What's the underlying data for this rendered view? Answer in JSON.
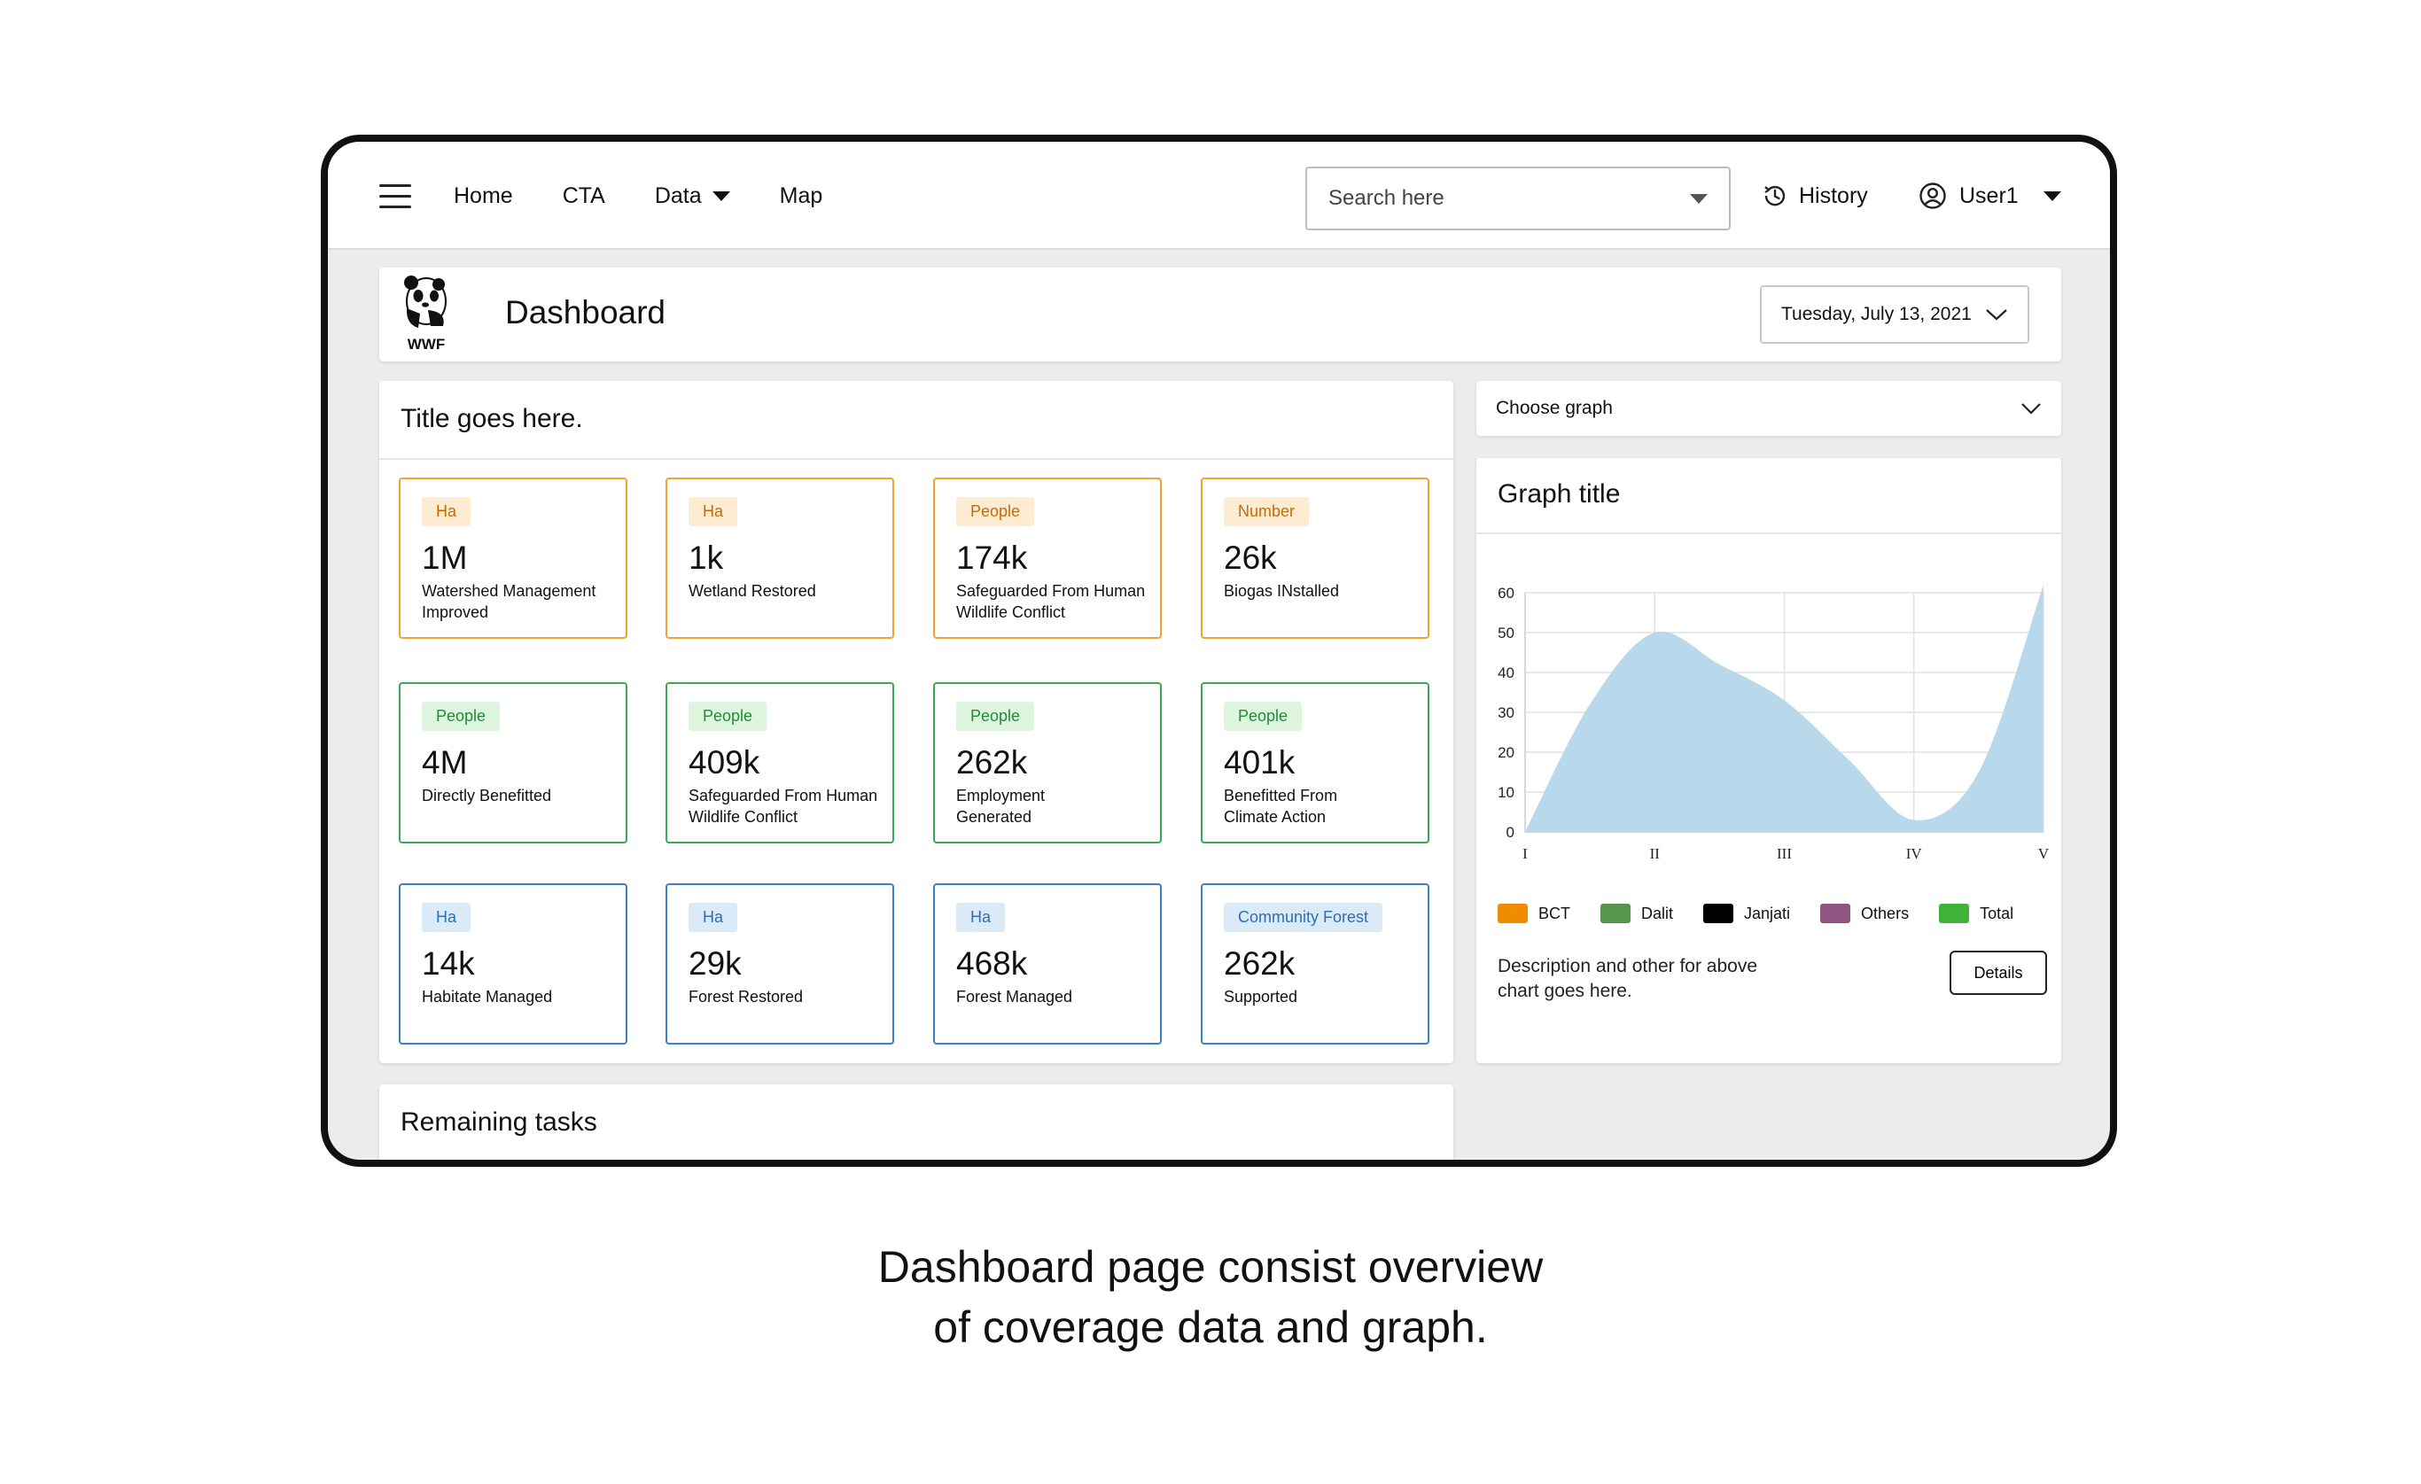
{
  "nav": {
    "links": [
      {
        "label": "Home"
      },
      {
        "label": "CTA"
      },
      {
        "label": "Data"
      },
      {
        "label": "Map"
      }
    ],
    "search_placeholder": "Search here",
    "history_label": "History",
    "user_label": "User1"
  },
  "header": {
    "logo_text": "WWF",
    "title": "Dashboard",
    "date": "Tuesday, July 13, 2021"
  },
  "main": {
    "title": "Title goes here.",
    "kpis": [
      {
        "badge": "Ha",
        "value": "1M",
        "label": "Watershed Management Improved",
        "color": "#f0a332"
      },
      {
        "badge": "Ha",
        "value": "1k",
        "label": "Wetland Restored",
        "color": "#f0a332"
      },
      {
        "badge": "People",
        "value": "174k",
        "label": "Safeguarded From Human Wildlife Conflict",
        "color": "#f0a332"
      },
      {
        "badge": "Number",
        "value": "26k",
        "label": "Biogas INstalled",
        "color": "#f0a332"
      },
      {
        "badge": "People",
        "value": "4M",
        "label": "Directly Benefitted",
        "color": "#38a955"
      },
      {
        "badge": "People",
        "value": "409k",
        "label": "Safeguarded From Human Wildlife Conflict",
        "color": "#38a955"
      },
      {
        "badge": "People",
        "value": "262k",
        "label": "Employment Generated",
        "color": "#38a955"
      },
      {
        "badge": "People",
        "value": "401k",
        "label": "Benefitted From Climate Action",
        "color": "#38a955"
      },
      {
        "badge": "Ha",
        "value": "14k",
        "label": "Habitate Managed",
        "color": "#3c7fc6"
      },
      {
        "badge": "Ha",
        "value": "29k",
        "label": "Forest Restored",
        "color": "#3c7fc6"
      },
      {
        "badge": "Ha",
        "value": "468k",
        "label": "Forest Managed",
        "color": "#3c7fc6"
      },
      {
        "badge": "Community Forest",
        "value": "262k",
        "label": "Supported",
        "color": "#3c7fc6"
      }
    ]
  },
  "tasks": {
    "title": "Remaining tasks"
  },
  "graph": {
    "select_label": "Choose graph",
    "title": "Graph title",
    "description": "Description and other for above chart goes here.",
    "details_label": "Details",
    "legend": [
      {
        "name": "BCT",
        "color": "#ef8c00"
      },
      {
        "name": "Dalit",
        "color": "#57954c"
      },
      {
        "name": "Janjati",
        "color": "#000000"
      },
      {
        "name": "Others",
        "color": "#8e5580"
      },
      {
        "name": "Total",
        "color": "#3fb23a"
      }
    ]
  },
  "chart_data": {
    "type": "area",
    "x": [
      "I",
      "II",
      "III",
      "IV",
      "V"
    ],
    "x_positions": [
      0,
      1,
      2,
      3,
      4
    ],
    "curve_points": [
      [
        0,
        0
      ],
      [
        0.5,
        32
      ],
      [
        1,
        50
      ],
      [
        1.5,
        42
      ],
      [
        2,
        33
      ],
      [
        2.5,
        18
      ],
      [
        3,
        3
      ],
      [
        3.5,
        15
      ],
      [
        4,
        62
      ]
    ],
    "ylim": [
      0,
      60
    ],
    "yticks": [
      0,
      10,
      20,
      30,
      40,
      50,
      60
    ],
    "fill_color": "#b8d9ec",
    "grid": true
  },
  "caption": {
    "line1": "Dashboard page consist overview",
    "line2": "of coverage data and graph."
  }
}
